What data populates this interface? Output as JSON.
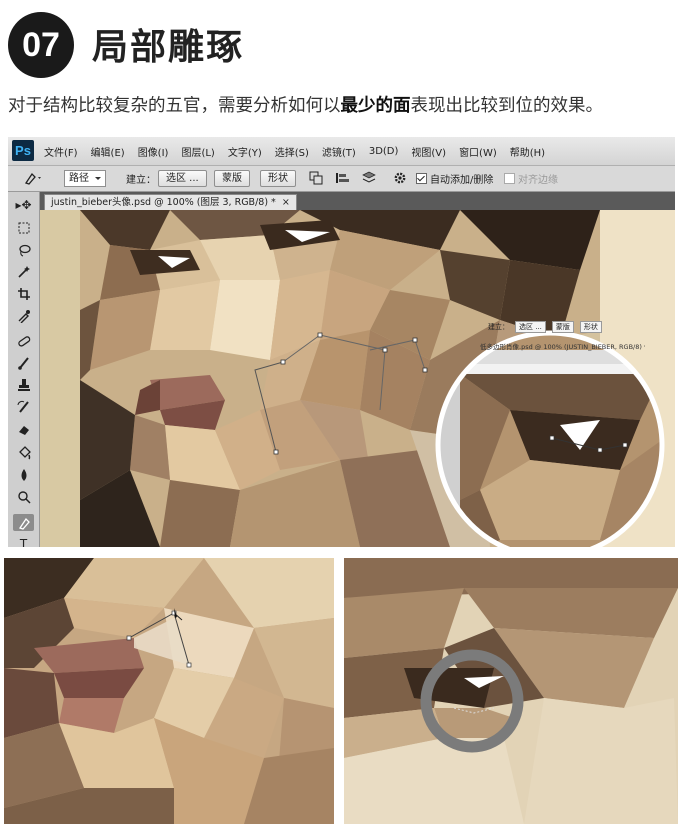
{
  "header": {
    "step_number": "07",
    "title": "局部雕琢",
    "subtitle_pre": "对于结构比较复杂的五官，需要分析如何以",
    "subtitle_bold": "最少的面",
    "subtitle_post": "表现出比较到位的效果。"
  },
  "photoshop": {
    "logo": "Ps",
    "menu": [
      "文件(F)",
      "编辑(E)",
      "图像(I)",
      "图层(L)",
      "文字(Y)",
      "选择(S)",
      "滤镜(T)",
      "3D(D)",
      "视图(V)",
      "窗口(W)",
      "帮助(H)"
    ],
    "options": {
      "mode_select": "路径",
      "build_label": "建立：",
      "selection_button": "选区 ...",
      "mask_button": "蒙版",
      "shape_button": "形状",
      "auto_add_delete_label": "自动添加/删除",
      "auto_add_delete_checked": true,
      "align_edges_label": "对齐边缘",
      "align_edges_checked": false
    },
    "document_tab": "justin_bieber头像.psd @ 100% (图层 3, RGB/8) *",
    "inset": {
      "build_label": "建立：",
      "selection_button": "选区 ...",
      "mask_button": "蒙版",
      "shape_button": "形状",
      "document_tab": "低多边形肖像.psd @ 100% (JUSTIN_BIEBER, RGB/8) *"
    }
  },
  "colors": {
    "badge_bg": "#1a1a1a",
    "skin_light": "#ecd9bd",
    "skin_mid": "#c9a883",
    "skin_dark": "#8a6a4e",
    "lip": "#9c6a5c",
    "hair": "#3a2b20",
    "ring_gray": "#7b7b7b"
  },
  "icons": [
    "move-icon",
    "marquee-icon",
    "lasso-icon",
    "magic-wand-icon",
    "crop-icon",
    "eyedropper-icon",
    "healing-brush-icon",
    "brush-icon",
    "stamp-icon",
    "history-brush-icon",
    "eraser-icon",
    "paint-bucket-icon",
    "blur-icon",
    "dodge-icon",
    "pen-icon",
    "type-icon"
  ]
}
